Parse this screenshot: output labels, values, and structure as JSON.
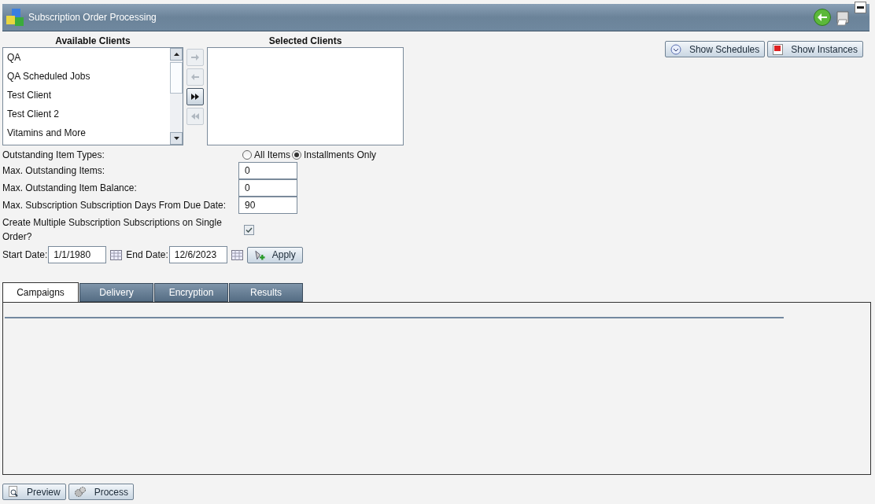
{
  "window": {
    "title": "Subscription Order Processing"
  },
  "available_clients": {
    "heading": "Available Clients",
    "items": [
      "QA",
      "QA Scheduled Jobs",
      "Test Client",
      "Test Client 2",
      "Vitamins and More"
    ]
  },
  "transfer_buttons": [
    {
      "kind": "add",
      "disabled": true
    },
    {
      "kind": "remove",
      "disabled": true
    },
    {
      "kind": "add_all",
      "disabled": false
    },
    {
      "kind": "remove_all",
      "disabled": true
    }
  ],
  "selected_clients": {
    "heading": "Selected Clients"
  },
  "top_buttons": [
    {
      "kind": "clock",
      "label": "Show Schedules"
    },
    {
      "kind": "calendar",
      "label": "Show Instances"
    }
  ],
  "outstanding_item_types": {
    "label": "Outstanding Item Types:",
    "options": [
      {
        "label": "All Items",
        "selected": false
      },
      {
        "label": "Installments Only",
        "selected": true
      }
    ]
  },
  "fields": [
    {
      "label": "Max. Outstanding Items:",
      "value": "0"
    },
    {
      "label": "Max. Outstanding Item Balance:",
      "value": "0"
    },
    {
      "label": "Max. Subscription Subscription Days From Due Date:",
      "value": "90"
    }
  ],
  "multiple_subscriptions": {
    "label": "Create Multiple Subscription Subscriptions on Single Order?",
    "checked": true
  },
  "dates": {
    "start_label": "Start Date:",
    "start_value": "1/1/1980",
    "end_label": "End Date:",
    "end_value": "12/6/2023",
    "apply": "Apply"
  },
  "tabs": [
    {
      "label": "Campaigns",
      "selected": true
    },
    {
      "label": "Delivery",
      "selected": false
    },
    {
      "label": "Encryption",
      "selected": false
    },
    {
      "label": "Results",
      "selected": false
    }
  ],
  "bottom_buttons": [
    {
      "kind": "preview",
      "label": "Preview"
    },
    {
      "kind": "process",
      "label": "Process"
    }
  ]
}
